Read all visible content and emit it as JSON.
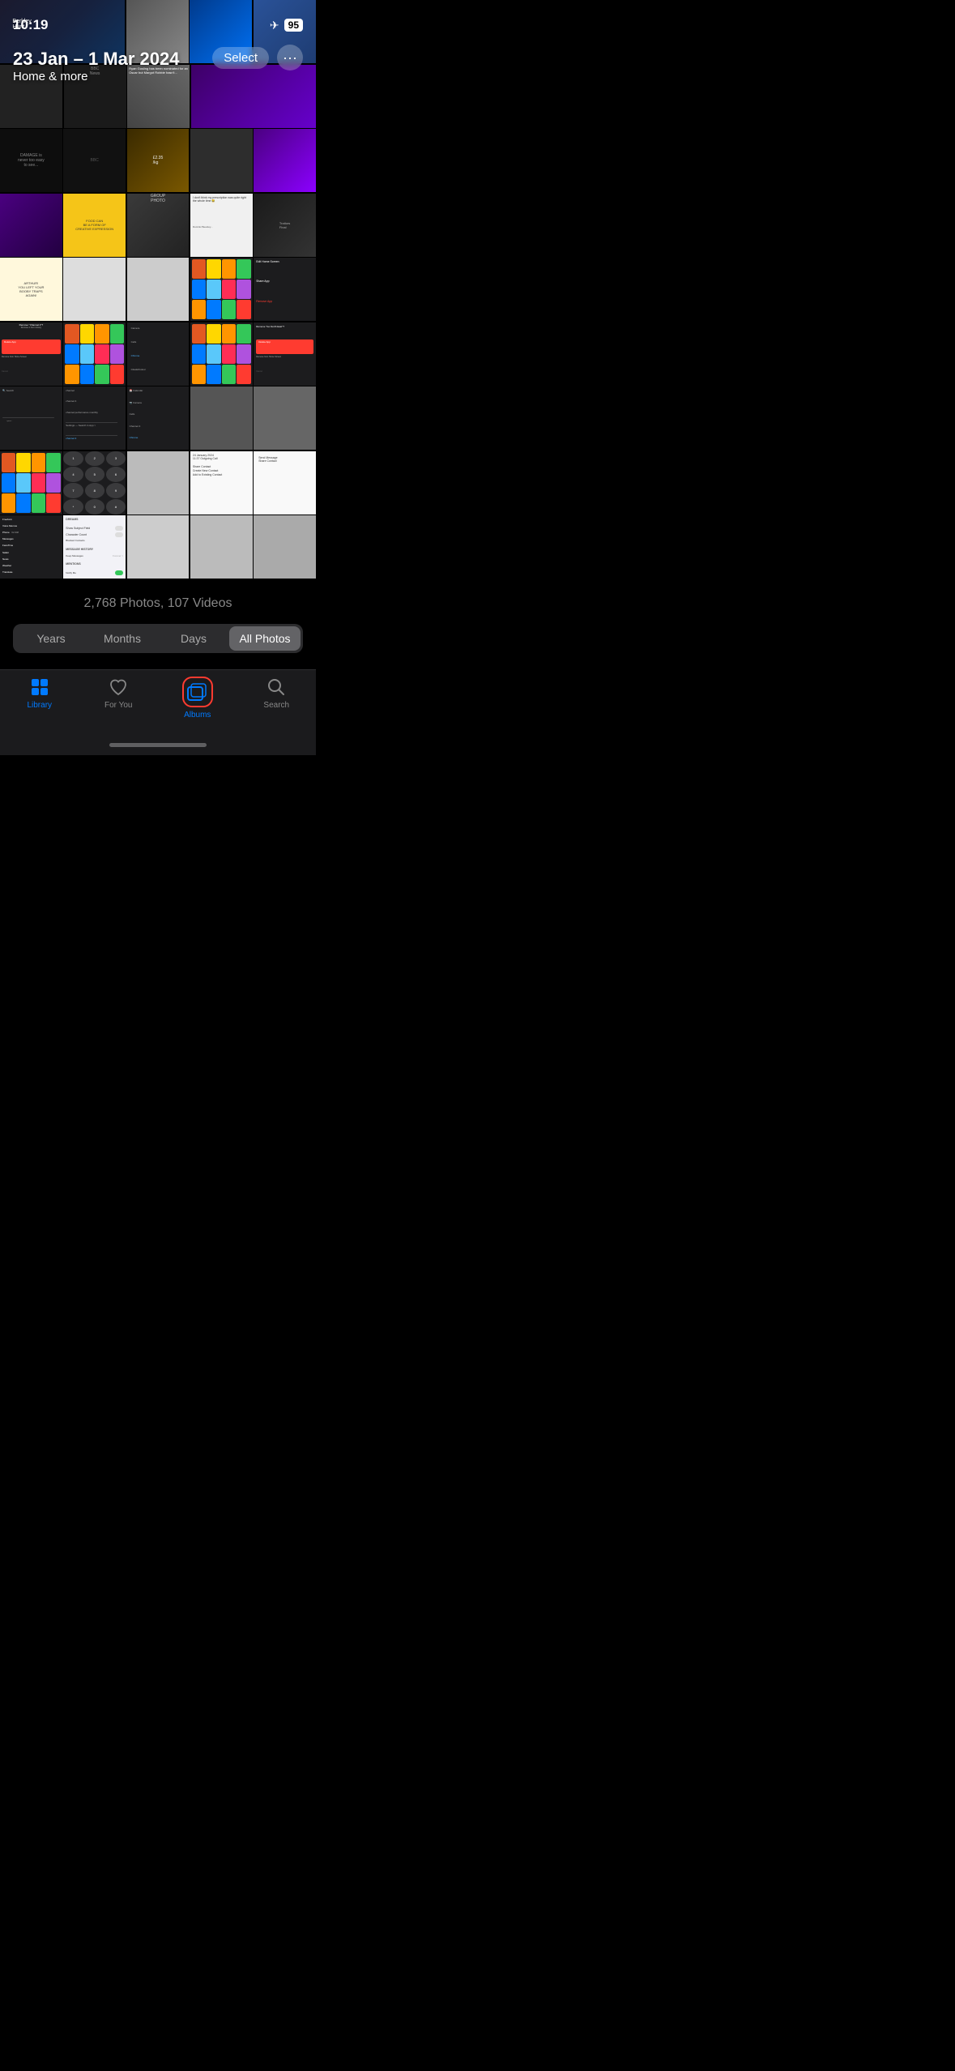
{
  "statusBar": {
    "time": "10:19",
    "planeIcon": "✈",
    "batteryNum": "95"
  },
  "header": {
    "dateRange": "23 Jan – 1 Mar 2024",
    "subtitle": "Home & more",
    "selectLabel": "Select",
    "moreIcon": "···"
  },
  "photoCount": "2,768 Photos, 107 Videos",
  "segControl": {
    "items": [
      "Years",
      "Months",
      "Days",
      "All Photos"
    ],
    "activeIndex": 3
  },
  "bottomNav": {
    "items": [
      {
        "id": "library",
        "label": "Library",
        "active": true
      },
      {
        "id": "for-you",
        "label": "For You",
        "active": false
      },
      {
        "id": "albums",
        "label": "Albums",
        "active": false,
        "highlighted": true
      },
      {
        "id": "search",
        "label": "Search",
        "active": false
      }
    ]
  },
  "screenshots": {
    "chromeLabelRow": "Chrome",
    "showSubjectField": "Show Subject Field",
    "characterCount": "Character Count"
  }
}
